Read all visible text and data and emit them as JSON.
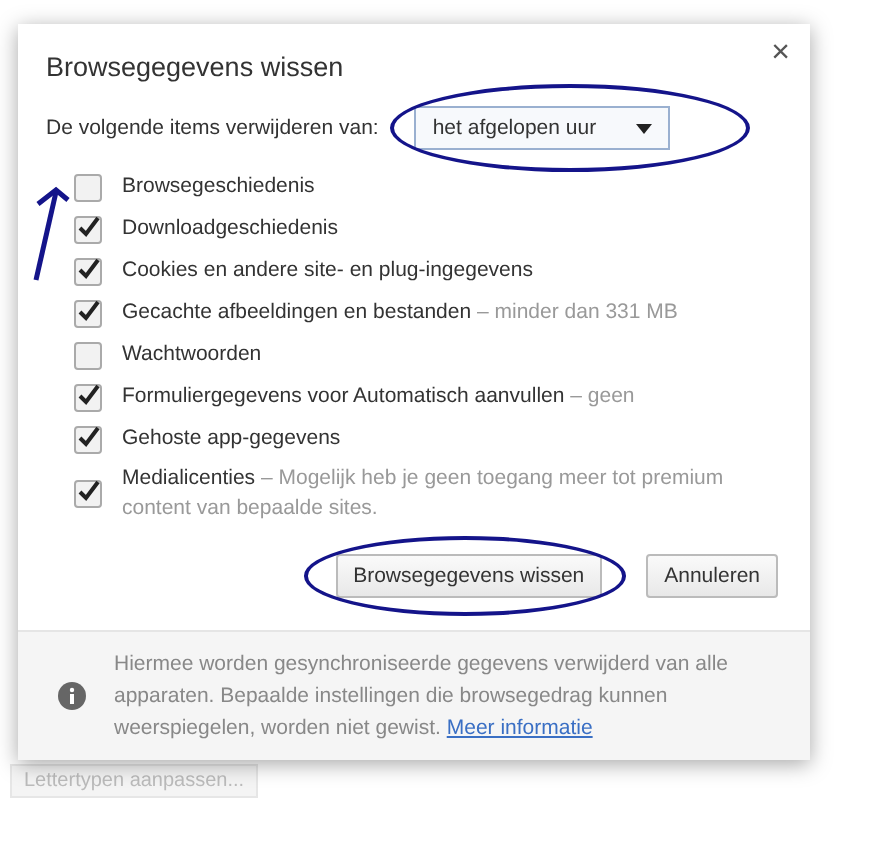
{
  "dialog": {
    "title": "Browsegegevens wissen",
    "close": "×",
    "range_label": "De volgende items verwijderen van:",
    "range_value": "het afgelopen uur",
    "items": [
      {
        "label": "Browsegeschiedenis",
        "checked": false
      },
      {
        "label": "Downloadgeschiedenis",
        "checked": true
      },
      {
        "label": "Cookies en andere site- en plug-ingegevens",
        "checked": true
      },
      {
        "label": "Gecachte afbeeldingen en bestanden",
        "detail": "minder dan 331 MB",
        "checked": true
      },
      {
        "label": "Wachtwoorden",
        "checked": false
      },
      {
        "label": "Formuliergegevens voor Automatisch aanvullen",
        "detail": "geen",
        "checked": true
      },
      {
        "label": "Gehoste app-gegevens",
        "checked": true
      },
      {
        "label": "Medialicenties",
        "detail": "Mogelijk heb je geen toegang meer tot premium content van bepaalde sites.",
        "checked": true
      }
    ],
    "separator": "–",
    "buttons": [
      "Browsegegevens wissen",
      "Annuleren"
    ],
    "footer": {
      "text": "Hiermee worden gesynchroniseerde gegevens verwijderd van alle apparaten. Bepaalde instellingen die browsegedrag kunnen weerspiegelen, worden niet gewist.",
      "link": "Meer informatie"
    }
  },
  "background": {
    "button": "Lettertypen aanpassen..."
  }
}
